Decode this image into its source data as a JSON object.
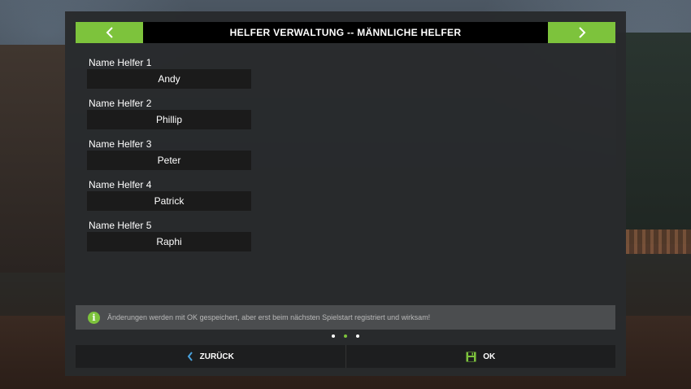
{
  "header": {
    "title": "HELFER VERWALTUNG -- MÄNNLICHE HELFER",
    "prev_icon": "chevron-left-icon",
    "next_icon": "chevron-right-icon"
  },
  "helpers": [
    {
      "label": "Name Helfer 1",
      "value": "Andy"
    },
    {
      "label": "Name Helfer 2",
      "value": "Phillip"
    },
    {
      "label": "Name Helfer 3",
      "value": "Peter"
    },
    {
      "label": "Name Helfer 4",
      "value": "Patrick"
    },
    {
      "label": "Name Helfer 5",
      "value": "Raphi"
    }
  ],
  "info": {
    "icon": "info-icon",
    "symbol": "i",
    "text": "Änderungen werden mit OK gespeichert, aber erst beim nächsten Spielstart registriert und wirksam!"
  },
  "pagination": {
    "pages": 3,
    "active": 2
  },
  "footer": {
    "back_label": "ZURÜCK",
    "ok_label": "OK"
  },
  "colors": {
    "accent": "#7dc33c",
    "panel": "#28292b",
    "header": "#000000",
    "field": "#1b1b1b",
    "back_icon": "#4aa3df"
  }
}
